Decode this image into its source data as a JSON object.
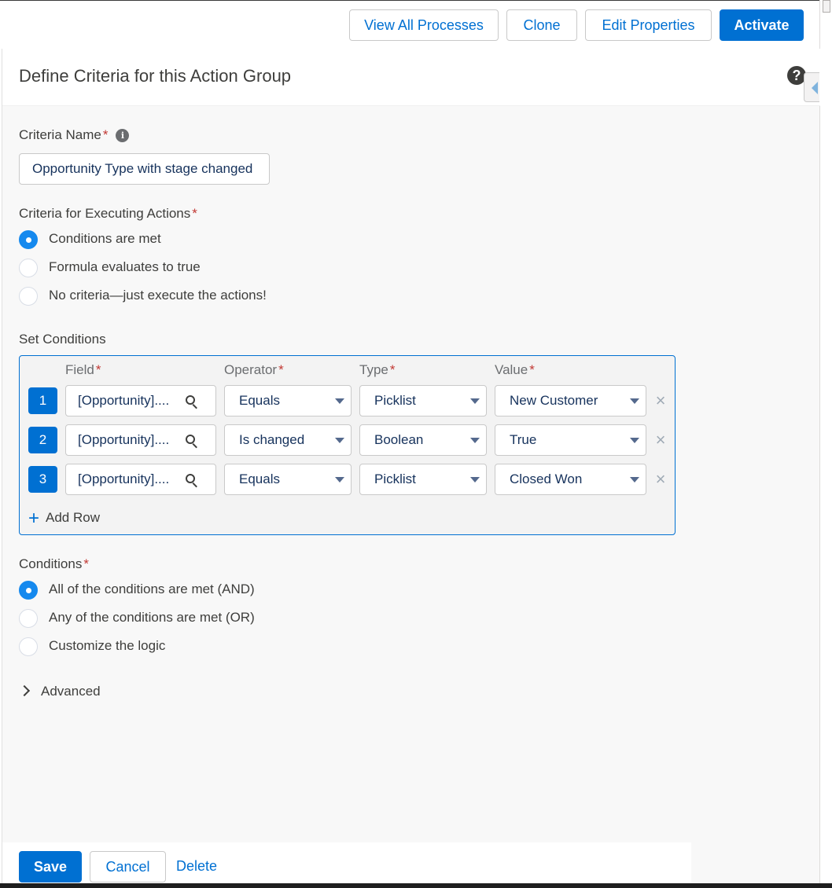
{
  "toolbar": {
    "view_all_processes": "View All Processes",
    "clone": "Clone",
    "edit_properties": "Edit Properties",
    "activate": "Activate"
  },
  "panel": {
    "title": "Define Criteria for this Action Group",
    "help_icon": "help-icon"
  },
  "criteria_name": {
    "label": "Criteria Name",
    "required": "*",
    "info_icon": "info-icon",
    "value": "Opportunity Type with stage changed"
  },
  "executing_actions": {
    "label": "Criteria for Executing Actions",
    "required": "*",
    "options": [
      {
        "label": "Conditions are met",
        "checked": true
      },
      {
        "label": "Formula evaluates to true",
        "checked": false
      },
      {
        "label": "No criteria—just execute the actions!",
        "checked": false
      }
    ]
  },
  "set_conditions": {
    "label": "Set Conditions",
    "headers": {
      "field": "Field",
      "operator": "Operator",
      "type": "Type",
      "value": "Value",
      "required": "*"
    },
    "rows": [
      {
        "num": "1",
        "field": "[Opportunity]....",
        "operator": "Equals",
        "type": "Picklist",
        "value": "New Customer"
      },
      {
        "num": "2",
        "field": "[Opportunity]....",
        "operator": "Is changed",
        "type": "Boolean",
        "value": "True"
      },
      {
        "num": "3",
        "field": "[Opportunity]....",
        "operator": "Equals",
        "type": "Picklist",
        "value": "Closed Won"
      }
    ],
    "add_row": "Add Row"
  },
  "conditions": {
    "label": "Conditions",
    "required": "*",
    "options": [
      {
        "label": "All of the conditions are met (AND)",
        "checked": true
      },
      {
        "label": "Any of the conditions are met (OR)",
        "checked": false
      },
      {
        "label": "Customize the logic",
        "checked": false
      }
    ]
  },
  "advanced": {
    "label": "Advanced"
  },
  "footer": {
    "save": "Save",
    "cancel": "Cancel",
    "delete": "Delete"
  },
  "colors": {
    "brand": "#0070d2",
    "radio_checked": "#1589ee",
    "required": "#c23934"
  }
}
